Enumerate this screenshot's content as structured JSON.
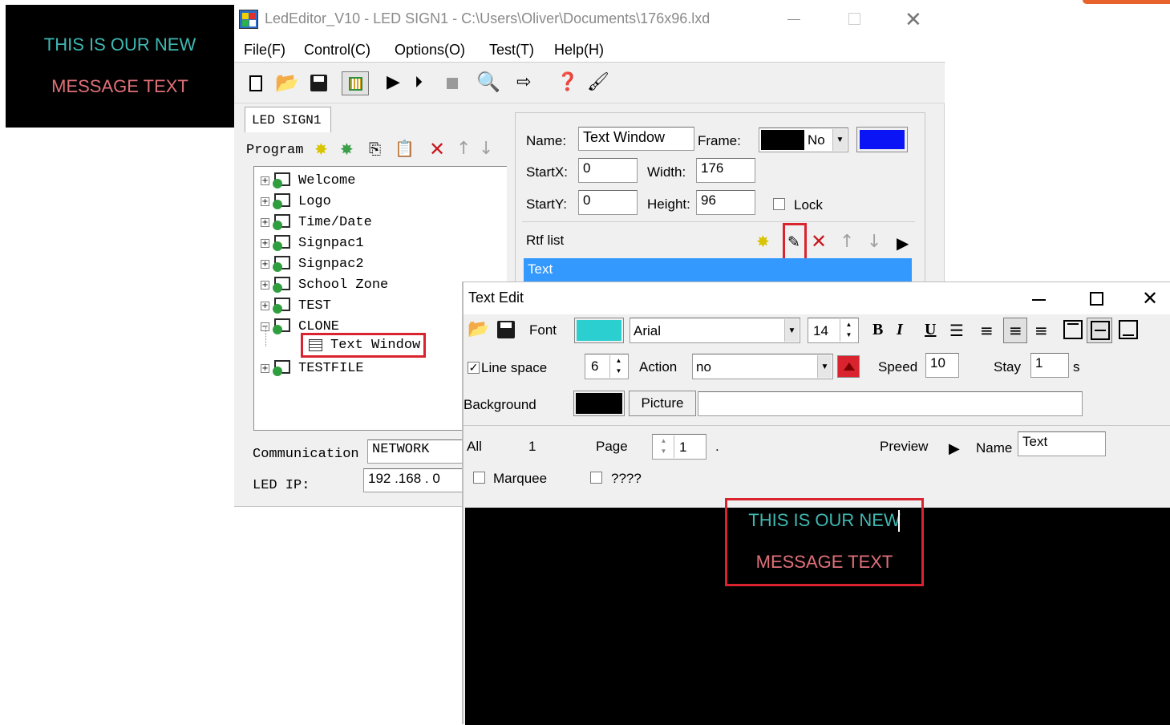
{
  "led_preview": {
    "line1": "THIS IS OUR NEW",
    "line2": "MESSAGE TEXT"
  },
  "main_window": {
    "title": "LedEditor_V10 - LED SIGN1 - C:\\Users\\Oliver\\Documents\\176x96.lxd",
    "menu": [
      "File(F)",
      "Control(C)",
      "Options(O)",
      "Test(T)",
      "Help(H)"
    ],
    "tab_label": "LED SIGN1",
    "program_label": "Program",
    "tree": [
      {
        "label": "Welcome"
      },
      {
        "label": "Logo"
      },
      {
        "label": "Time/Date"
      },
      {
        "label": "Signpac1"
      },
      {
        "label": "Signpac2"
      },
      {
        "label": "School Zone"
      },
      {
        "label": "TEST"
      },
      {
        "label": "CLONE"
      },
      {
        "label": "Text Window"
      },
      {
        "label": "TESTFILE"
      }
    ],
    "communication_label": "Communication",
    "communication_value": "NETWORK",
    "led_ip_label": "LED IP:",
    "led_ip_value": "192 .168 .  0",
    "props": {
      "name_label": "Name:",
      "name_value": "Text Window",
      "frame_label": "Frame:",
      "frame_value": "No",
      "startx_label": "StartX:",
      "startx_value": "0",
      "width_label": "Width:",
      "width_value": "176",
      "starty_label": "StartY:",
      "starty_value": "0",
      "height_label": "Height:",
      "height_value": "96",
      "lock_label": "Lock",
      "rtf_label": "Rtf list",
      "rtf_item": "Text"
    }
  },
  "text_edit": {
    "title": "Text Edit",
    "font_label": "Font",
    "font_value": "Arial",
    "font_size": "14",
    "font_color": "#2ccfd0",
    "line_space_label": "Line space",
    "line_space_value": "6",
    "action_label": "Action",
    "action_value": "no",
    "speed_label": "Speed",
    "speed_value": "10",
    "stay_label": "Stay",
    "stay_value": "1",
    "stay_unit": "s",
    "background_label": "Background",
    "picture_label": "Picture",
    "picture_path": "",
    "all_label": "All",
    "all_value": "1",
    "page_label": "Page",
    "page_value": "1",
    "page_dot": ".",
    "preview_label": "Preview",
    "name_label": "Name",
    "name_value": "Text",
    "marquee_label": "Marquee",
    "unknown_label": "????",
    "canvas_line1": "THIS IS OUR NEW",
    "canvas_line2": "MESSAGE TEXT"
  },
  "colors": {
    "cyan_text": "#3fb8b2",
    "pink_text": "#e0707a",
    "highlight_red": "#d9232e",
    "selection_blue": "#3399ff",
    "frame_blue": "#0a14f5"
  }
}
